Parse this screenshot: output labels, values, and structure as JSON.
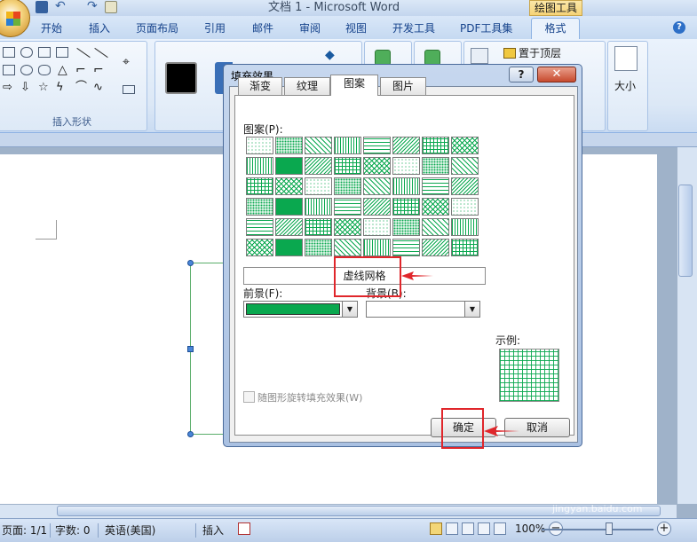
{
  "window": {
    "title": "文档 1 - Microsoft Word",
    "context_tab": "绘图工具"
  },
  "ribbon": {
    "tabs": [
      "开始",
      "插入",
      "页面布局",
      "引用",
      "邮件",
      "审阅",
      "视图",
      "开发工具",
      "PDF工具集"
    ],
    "active_tab": "格式",
    "group_insert_shapes": "插入形状",
    "bring_to_front": "置于顶层",
    "size_label": "大小",
    "help": "?"
  },
  "dialog": {
    "title": "填充效果",
    "help_button": "?",
    "close_button": "✕",
    "tabs": [
      "渐变",
      "纹理",
      "图案",
      "图片"
    ],
    "active_tab": "图案",
    "pattern_label": "图案(P):",
    "selected_pattern_name": "虚线网格",
    "foreground_label": "前景(F):",
    "foreground_color": "#0aa84f",
    "background_label": "背景(B):",
    "background_color": "#ffffff",
    "sample_label": "示例:",
    "rotate_checkbox_label": "随图形旋转填充效果(W)",
    "rotate_checked": false,
    "ok_button": "确定",
    "cancel_button": "取消"
  },
  "statusbar": {
    "page": "页面: 1/1",
    "words": "字数: 0",
    "language": "英语(美国)",
    "mode": "插入",
    "zoom": "100%"
  },
  "watermark": {
    "brand": "Bai  经验",
    "url": "jingyan.baidu.com"
  },
  "colors": {
    "accent_green": "#0aa84f",
    "annotation_red": "#e0262b",
    "ribbon_blue": "#15428b"
  }
}
